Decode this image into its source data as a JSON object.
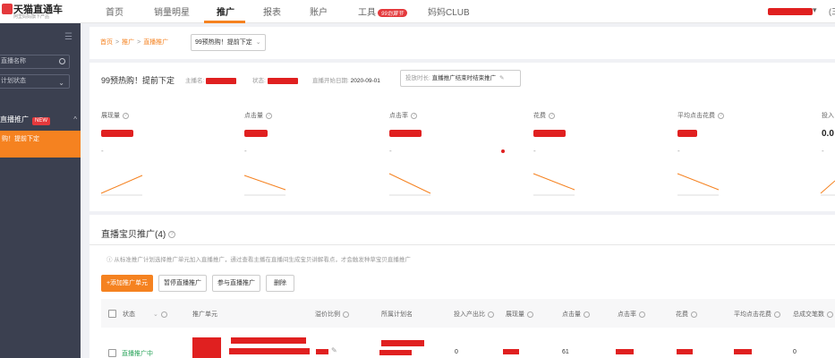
{
  "header": {
    "logo_name": "天猫直通车",
    "logo_subtitle": "阿里妈妈旗下产品",
    "nav": [
      {
        "label": "首页"
      },
      {
        "label": "销量明星"
      },
      {
        "label": "推广"
      },
      {
        "label": "报表"
      },
      {
        "label": "账户"
      },
      {
        "label": "工具"
      },
      {
        "label": "妈妈CLUB"
      }
    ],
    "tool_badge": "99划算节",
    "user_menu_caret": "▾",
    "user_extra": "(三"
  },
  "sidebar": {
    "search_placeholder": "直播名称",
    "status_select": "计划状态",
    "group_label": "直播推广",
    "group_badge": "NEW",
    "active_item": "购！提前下定"
  },
  "breadcrumb": {
    "items": [
      "首页",
      "推广",
      "直播推广"
    ],
    "current": "99预热购！提前下定"
  },
  "plan": {
    "title": "99预热购！提前下定",
    "host_label": "主播名:",
    "status_label": "状态:",
    "start_label": "直播开始日期:",
    "start_value": "2020-09-01",
    "end_label": "投放时长:",
    "end_value": "直播推广结束时结束推广"
  },
  "metrics": [
    {
      "label": "展现量"
    },
    {
      "label": "点击量"
    },
    {
      "label": "点击率"
    },
    {
      "label": "花费"
    },
    {
      "label": "平均点击花费"
    },
    {
      "label": "投入",
      "value": "0.0"
    }
  ],
  "metric_dash": "-",
  "section": {
    "title": "直播宝贝推广(4)",
    "tip": "从标准推广计划选择推广单元加入直播推广，通过查看主播在直播间生成宝贝讲解看点，才会触发种草宝贝直播推广",
    "buttons": {
      "add": "+添加推广单元",
      "pause": "暂停直播推广",
      "join": "参与直播推广",
      "delete": "删除"
    }
  },
  "table": {
    "headers": {
      "status": "状态",
      "unit": "推广单元",
      "ratio": "溢价比例",
      "plan_name": "所属计划名",
      "roi": "投入产出比",
      "impressions": "展现量",
      "clicks": "点击量",
      "ctr": "点击率",
      "cost": "花费",
      "cpc": "平均点击花费",
      "orders": "总成交笔数"
    },
    "row": {
      "status": "直播推广中",
      "roi": "0",
      "clicks": "61",
      "orders": "0"
    }
  },
  "colors": {
    "accent": "#f58220",
    "sidebar": "#3b4050",
    "redaction": "#e02020"
  }
}
